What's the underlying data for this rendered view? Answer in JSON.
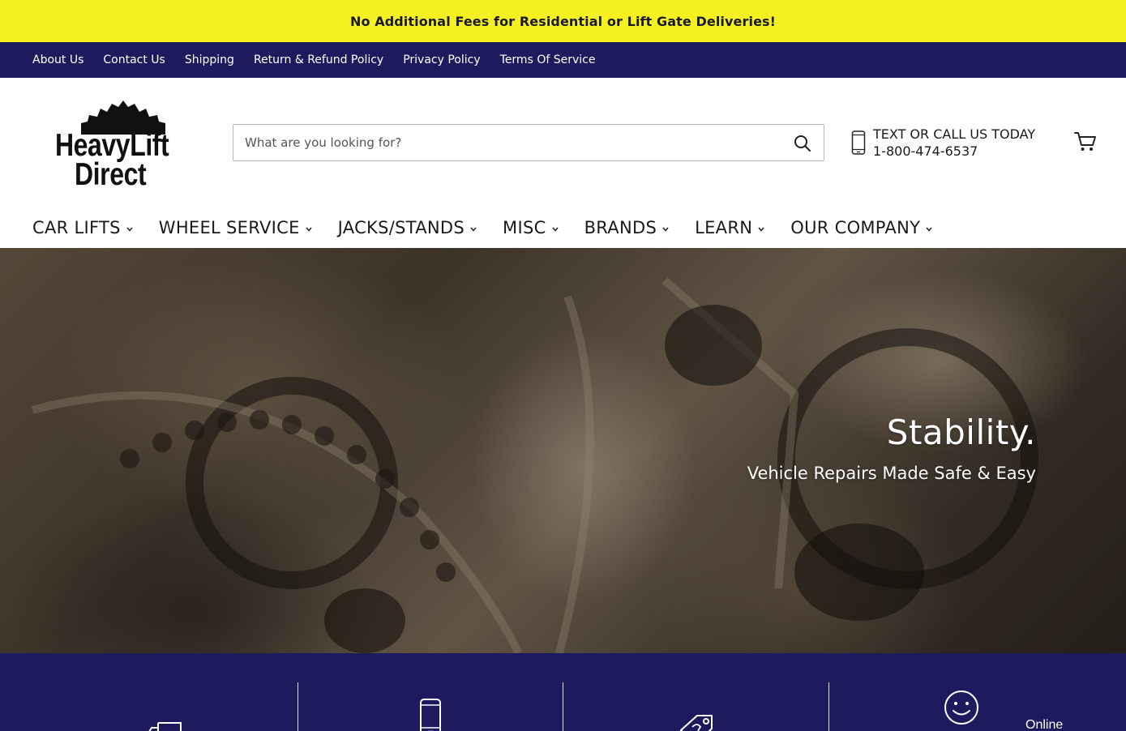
{
  "announcement": {
    "text": "No Additional Fees for Residential or Lift Gate Deliveries!"
  },
  "utility_nav": {
    "items": [
      {
        "label": "About Us"
      },
      {
        "label": "Contact Us"
      },
      {
        "label": "Shipping"
      },
      {
        "label": "Return & Refund Policy"
      },
      {
        "label": "Privacy Policy"
      },
      {
        "label": "Terms Of Service"
      }
    ]
  },
  "header": {
    "logo": {
      "line1": "HeavyLift",
      "line2": "Direct",
      "icon": "gear-icon"
    },
    "search": {
      "placeholder": "What are you looking for?",
      "value": "",
      "icon": "search-icon"
    },
    "contact": {
      "line1": "TEXT OR CALL US TODAY",
      "line2": "1-800-474-6537",
      "icon": "mobile-phone-icon"
    },
    "cart": {
      "icon": "shopping-cart-icon"
    }
  },
  "main_nav": {
    "items": [
      {
        "label": "CAR LIFTS"
      },
      {
        "label": "WHEEL SERVICE"
      },
      {
        "label": "JACKS/STANDS"
      },
      {
        "label": "MISC"
      },
      {
        "label": "BRANDS"
      },
      {
        "label": "LEARN"
      },
      {
        "label": "OUR COMPANY"
      }
    ]
  },
  "hero": {
    "title": "Stability.",
    "subtitle": "Vehicle Repairs Made Safe & Easy"
  },
  "features": {
    "icons": [
      "delivery-truck-icon",
      "mobile-phone-icon",
      "price-tag-icon",
      "smiley-face-icon"
    ]
  },
  "chat": {
    "status": "Online"
  },
  "colors": {
    "announcement_bg": "#f5f01f",
    "nav_bg": "#1e1a5e",
    "text": "#1a1a1a"
  }
}
